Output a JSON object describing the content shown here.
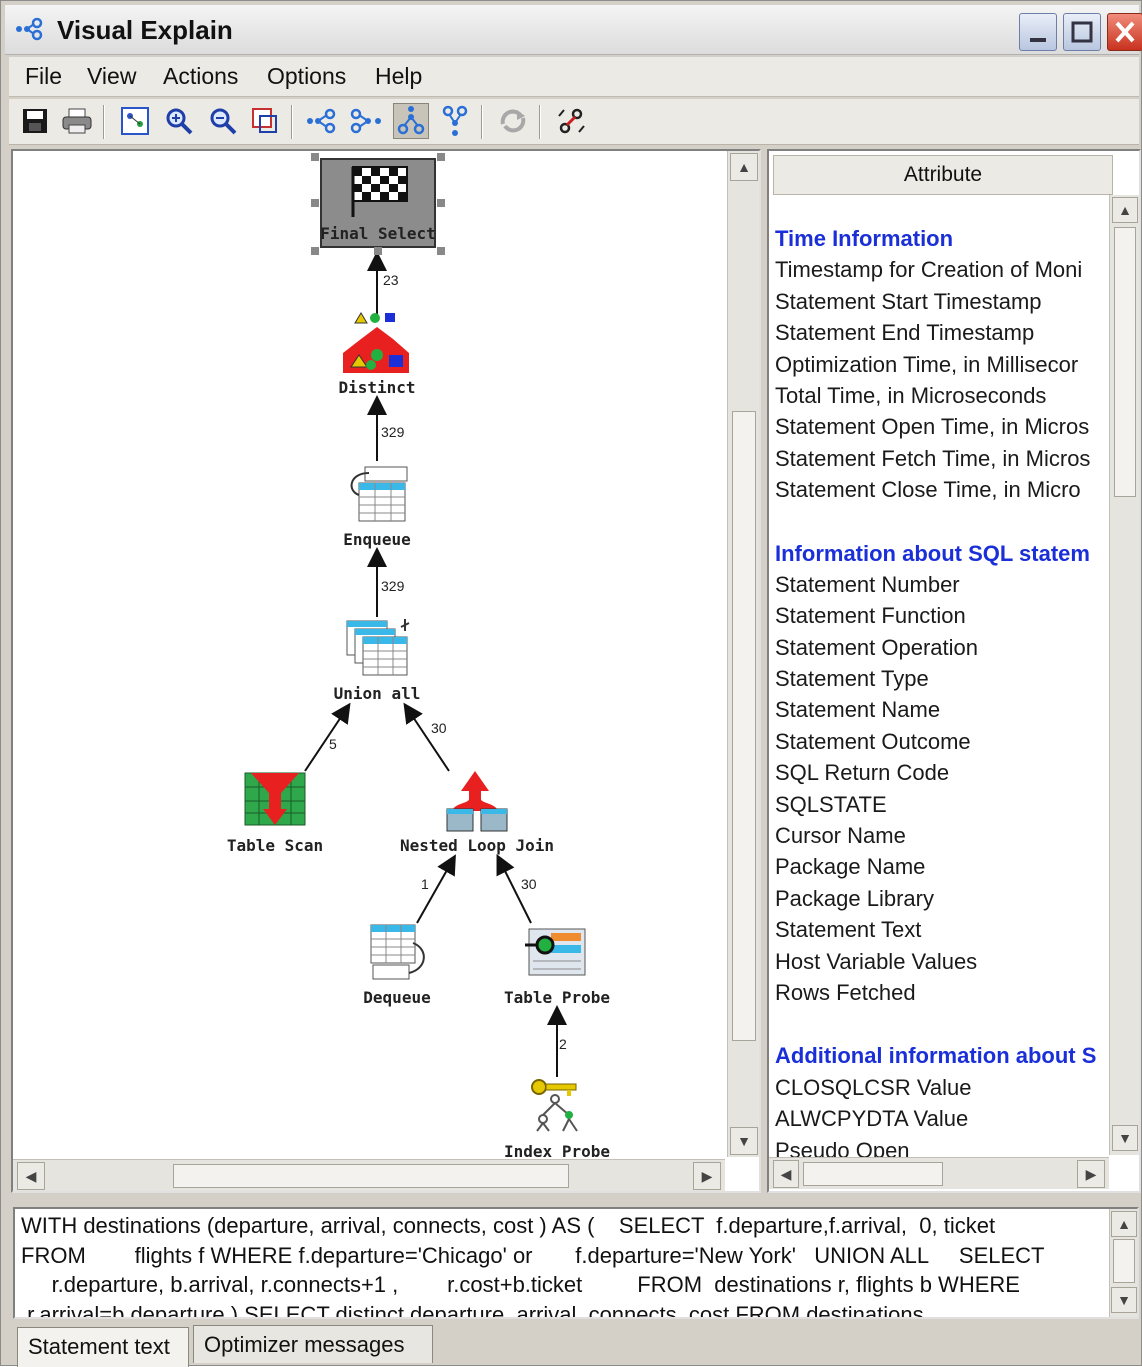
{
  "window": {
    "title": "Visual Explain"
  },
  "menu": [
    "File",
    "View",
    "Actions",
    "Options",
    "Help"
  ],
  "toolbar": {
    "icons": [
      "save-icon",
      "print-icon",
      "overview-icon",
      "zoom-in-icon",
      "zoom-out-icon",
      "zoom-fit-icon",
      "layout-horizontal-icon",
      "layout-tree-icon",
      "layout-vertical-icon",
      "layout-branch-icon",
      "refresh-icon",
      "highlight-icon"
    ],
    "pressed": "layout-vertical-icon"
  },
  "graph": {
    "nodes": {
      "final_select": "Final Select",
      "distinct": "Distinct",
      "enqueue": "Enqueue",
      "union_all": "Union all",
      "table_scan": "Table Scan",
      "nested_loop_join": "Nested Loop Join",
      "dequeue": "Dequeue",
      "table_probe": "Table Probe",
      "index_probe": "Index Probe"
    },
    "edges": {
      "distinct_to_final": "23",
      "enqueue_to_distinct": "329",
      "union_to_enqueue": "329",
      "scan_to_union": "5",
      "join_to_union": "30",
      "dequeue_to_join": "1",
      "probe_to_join": "30",
      "index_to_probe": "2"
    }
  },
  "attributes": {
    "header": "Attribute",
    "sections": [
      {
        "title": "Time Information",
        "rows": [
          "Timestamp for Creation of Moni",
          "Statement Start Timestamp",
          "Statement End Timestamp",
          "Optimization Time, in Millisecor",
          "Total Time, in Microseconds",
          "Statement Open Time, in Micros",
          "Statement Fetch Time, in Micros",
          "Statement Close Time, in Micro"
        ]
      },
      {
        "title": "Information about SQL statem",
        "rows": [
          "Statement Number",
          "Statement Function",
          "Statement Operation",
          "Statement Type",
          "Statement Name",
          "Statement Outcome",
          "SQL Return Code",
          "SQLSTATE",
          "Cursor Name",
          "Package Name",
          "Package Library",
          "Statement Text",
          "Host Variable Values",
          "Rows Fetched"
        ]
      },
      {
        "title": "Additional information about S",
        "rows": [
          "CLOSQLCSR Value",
          "ALWCPYDTA Value",
          "Pseudo Open"
        ]
      }
    ]
  },
  "statement": {
    "text": "WITH destinations (departure, arrival, connects, cost ) AS (    SELECT  f.departure,f.arrival,  0, ticket\nFROM        flights f WHERE f.departure='Chicago' or       f.departure='New York'   UNION ALL     SELECT\n     r.departure, b.arrival, r.connects+1 ,        r.cost+b.ticket         FROM  destinations r, flights b WHERE\n r.arrival=b.departure ) SELECT distinct departure, arrival, connects, cost FROM destinations"
  },
  "tabs": [
    "Statement text",
    "Optimizer messages"
  ]
}
